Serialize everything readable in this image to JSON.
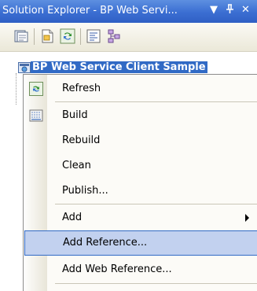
{
  "window": {
    "title": "Solution Explorer - BP Web Servi...",
    "dropdown_glyph": "▼",
    "pin_glyph": "ᚼ",
    "close_glyph": "✕"
  },
  "toolbar": {
    "icons": [
      "properties-icon",
      "show-all-files-icon",
      "refresh-icon",
      "view-code-icon",
      "class-view-icon"
    ]
  },
  "tree": {
    "project_label": "BP Web Service Client Sample"
  },
  "menu": {
    "items": [
      {
        "label": "Refresh",
        "icon": "refresh-icon"
      },
      {
        "label": "Build",
        "icon": "build-icon"
      },
      {
        "label": "Rebuild"
      },
      {
        "label": "Clean"
      },
      {
        "label": "Publish..."
      },
      {
        "label": "Add",
        "submenu": true
      },
      {
        "label": "Add Reference...",
        "highlighted": true
      },
      {
        "label": "Add Web Reference..."
      }
    ]
  },
  "colors": {
    "title_bar": "#3b6ed2",
    "selection": "#316ac5",
    "highlight_fill": "#c2d1ef"
  }
}
